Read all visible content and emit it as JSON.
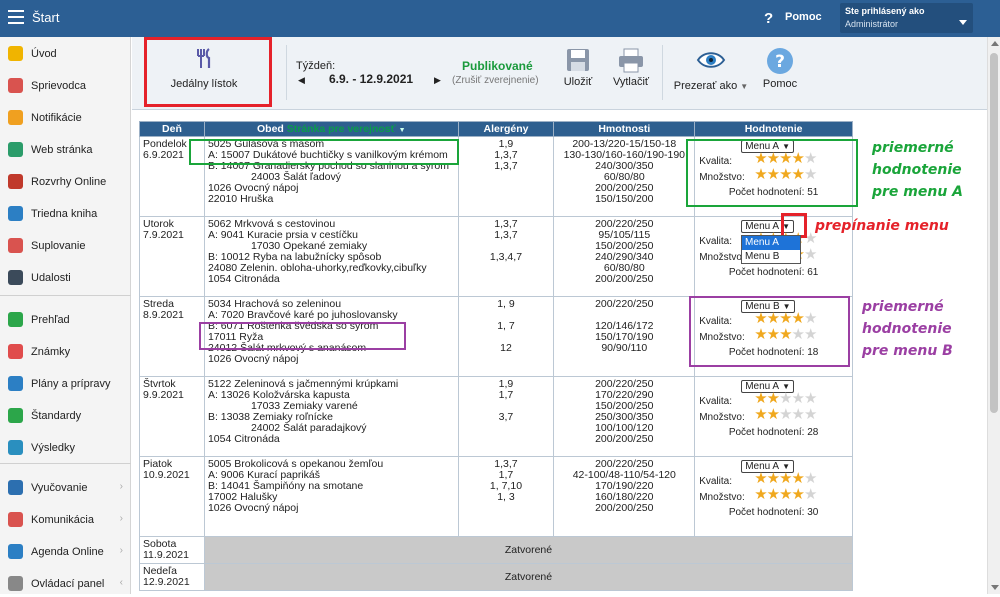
{
  "topbar": {
    "title": "Štart",
    "help_label": "Pomoc",
    "user_line1": "Ste prihlásený ako",
    "user_line2": "Administrátor"
  },
  "sidebar": {
    "items": [
      {
        "label": "Úvod",
        "icon": "star-icon",
        "color": "#f0b400"
      },
      {
        "label": "Sprievodca",
        "icon": "wand-icon",
        "color": "#d9534f"
      },
      {
        "label": "Notifikácie",
        "icon": "envelope-icon",
        "color": "#f0a020"
      },
      {
        "label": "Web stránka",
        "icon": "home-icon",
        "color": "#2b9c6a"
      },
      {
        "label": "Rozvrhy Online",
        "icon": "calendar-icon",
        "color": "#c0392b"
      },
      {
        "label": "Triedna kniha",
        "icon": "book-icon",
        "color": "#2c7fc4"
      },
      {
        "label": "Suplovanie",
        "icon": "person-icon",
        "color": "#d9534f"
      },
      {
        "label": "Udalosti",
        "icon": "events-icon",
        "color": "#3b4a5a"
      },
      {
        "label": "Prehľad",
        "icon": "check-circle-icon",
        "color": "#2ca64a"
      },
      {
        "label": "Známky",
        "icon": "grades-icon",
        "color": "#e04c4c"
      },
      {
        "label": "Plány a prípravy",
        "icon": "plans-icon",
        "color": "#2c7fc4"
      },
      {
        "label": "Štandardy",
        "icon": "shield-icon",
        "color": "#2ca64a"
      },
      {
        "label": "Výsledky",
        "icon": "bar-chart-icon",
        "color": "#2a8fbf"
      },
      {
        "label": "Vyučovanie",
        "icon": "folder-icon",
        "color": "#2c6fb0"
      },
      {
        "label": "Komunikácia",
        "icon": "chat-icon",
        "color": "#d9534f"
      },
      {
        "label": "Agenda Online",
        "icon": "pen-icon",
        "color": "#2c7fc4"
      },
      {
        "label": "Ovládací panel",
        "icon": "gear-icon",
        "color": "#888888"
      }
    ]
  },
  "toolbar": {
    "jedalny_listok": "Jedálny lístok",
    "week_label": "Týždeň:",
    "week_range": "6.9. - 12.9.2021",
    "status": "Publikované",
    "unpublish": "(Zrušiť zverejnenie)",
    "save": "Uložiť",
    "print": "Vytlačiť",
    "view_as": "Prezerať ako",
    "help": "Pomoc"
  },
  "table": {
    "headers": {
      "den": "Deň",
      "obed": "Obed",
      "obed_link": "Stránka pre verejnosť",
      "alergeny": "Alergény",
      "hmotnosti": "Hmotnosti",
      "hodnotenie": "Hodnotenie"
    },
    "days": [
      {
        "name": "Pondelok",
        "date": "6.9.2021",
        "lines": [
          "5025 Gulášová s mäsom",
          "A: 15007 Dukátové buchtičky s vanilkovým krémom",
          "B: 14007 Granadiersky pochod so slaninou a syrom",
          "24003 Šalát ľadový",
          "1026 Ovocný nápoj",
          "22010 Hruška"
        ],
        "indent": [
          0,
          0,
          0,
          2,
          0,
          0
        ],
        "allergens": [
          "1,9",
          "1,3,7",
          "1,3,7",
          "",
          "",
          ""
        ],
        "weights": [
          "200-13/220-15/150-18",
          "130-130/160-160/190-190",
          "240/300/350",
          "60/80/80",
          "200/200/250",
          "150/150/200"
        ],
        "menu": "Menu A",
        "quality": 4,
        "quantity": 4,
        "count_label": "Počet hodnotení: 51"
      },
      {
        "name": "Utorok",
        "date": "7.9.2021",
        "lines": [
          "5062 Mrkvová s cestovinou",
          "A: 9041 Kuracie prsia v cestíčku",
          "17030 Opekané zemiaky",
          "B: 10012 Ryba na labužnícky spôsob",
          "24080 Zelenin. obloha-uhorky,reďkovky,cibuľky",
          "1054 Citronáda"
        ],
        "indent": [
          0,
          0,
          2,
          0,
          0,
          0
        ],
        "allergens": [
          "1,3,7",
          "1,3,7",
          "",
          "1,3,4,7",
          "",
          ""
        ],
        "weights": [
          "200/220/250",
          "95/105/115",
          "150/200/250",
          "240/290/340",
          "60/80/80",
          "200/200/250"
        ],
        "menu": "Menu A",
        "quality": 4,
        "quantity": 4,
        "count_label": "Počet hodnotení: 61"
      },
      {
        "name": "Streda",
        "date": "8.9.2021",
        "lines": [
          "5034 Hrachová so zeleninou",
          "A: 7020 Bravčové karé po juhoslovansky",
          "B: 6071 Roštenka švédska so syrom",
          "17011 Ryža",
          "24012 Šalát mrkvový s ananásom",
          "1026 Ovocný nápoj"
        ],
        "indent": [
          0,
          0,
          0,
          0,
          0,
          0
        ],
        "allergens": [
          "1, 9",
          "",
          "1, 7",
          "",
          "12",
          ""
        ],
        "weights": [
          "200/220/250",
          "",
          "120/146/172",
          "150/170/190",
          "90/90/110",
          ""
        ],
        "menu": "Menu B",
        "quality": 4,
        "quantity": 3,
        "count_label": "Počet hodnotení: 18"
      },
      {
        "name": "Štvrtok",
        "date": "9.9.2021",
        "lines": [
          "5122 Zeleninová s jačmennými krúpkami",
          "A: 13026 Koložvárska kapusta",
          "17033 Zemiaky varené",
          "B: 13038 Zemiaky roľnícke",
          "24002 Šalát paradajkový",
          "1054 Citronáda"
        ],
        "indent": [
          0,
          0,
          2,
          0,
          2,
          0
        ],
        "allergens": [
          "1,9",
          "1,7",
          "",
          "3,7",
          "",
          ""
        ],
        "weights": [
          "200/220/250",
          "170/220/290",
          "150/200/250",
          "250/300/350",
          "100/100/120",
          "200/200/250"
        ],
        "menu": "Menu A",
        "quality": 2,
        "quantity": 2,
        "count_label": "Počet hodnotení: 28"
      },
      {
        "name": "Piatok",
        "date": "10.9.2021",
        "lines": [
          "5005 Brokolicová s opekanou žemľou",
          "A: 9006 Kurací paprikáš",
          "B: 14041 Šampiňóny na smotane",
          "17002 Halušky",
          "1026 Ovocný nápoj"
        ],
        "indent": [
          0,
          0,
          0,
          0,
          0
        ],
        "allergens": [
          "1,3,7",
          "1,7",
          "1, 7,10",
          "1, 3",
          ""
        ],
        "weights": [
          "200/220/250",
          "42-100/48-110/54-120",
          "170/190/220",
          "160/180/220",
          "200/200/250"
        ],
        "menu": "Menu A",
        "quality": 4,
        "quantity": 4,
        "count_label": "Počet hodnotení: 30"
      }
    ],
    "closed_days": [
      {
        "name": "Sobota",
        "date": "11.9.2021",
        "label": "Zatvorené"
      },
      {
        "name": "Nedeľa",
        "date": "12.9.2021",
        "label": "Zatvorené"
      }
    ],
    "quality_label": "Kvalita:",
    "quantity_label": "Množstvo:"
  },
  "dropdown": {
    "options": [
      "Menu A",
      "Menu B"
    ],
    "selected": "Menu A"
  },
  "annotations": {
    "avg_a": [
      "priemerné",
      "hodnotenie",
      "pre menu A"
    ],
    "switch": "prepínanie menu",
    "avg_b": [
      "priemerné",
      "hodnotenie",
      "pre menu B"
    ]
  },
  "colors": {
    "green": "#1aa53a",
    "red": "#e5222a",
    "purple": "#9b3fa3",
    "header": "#2c5f94"
  }
}
